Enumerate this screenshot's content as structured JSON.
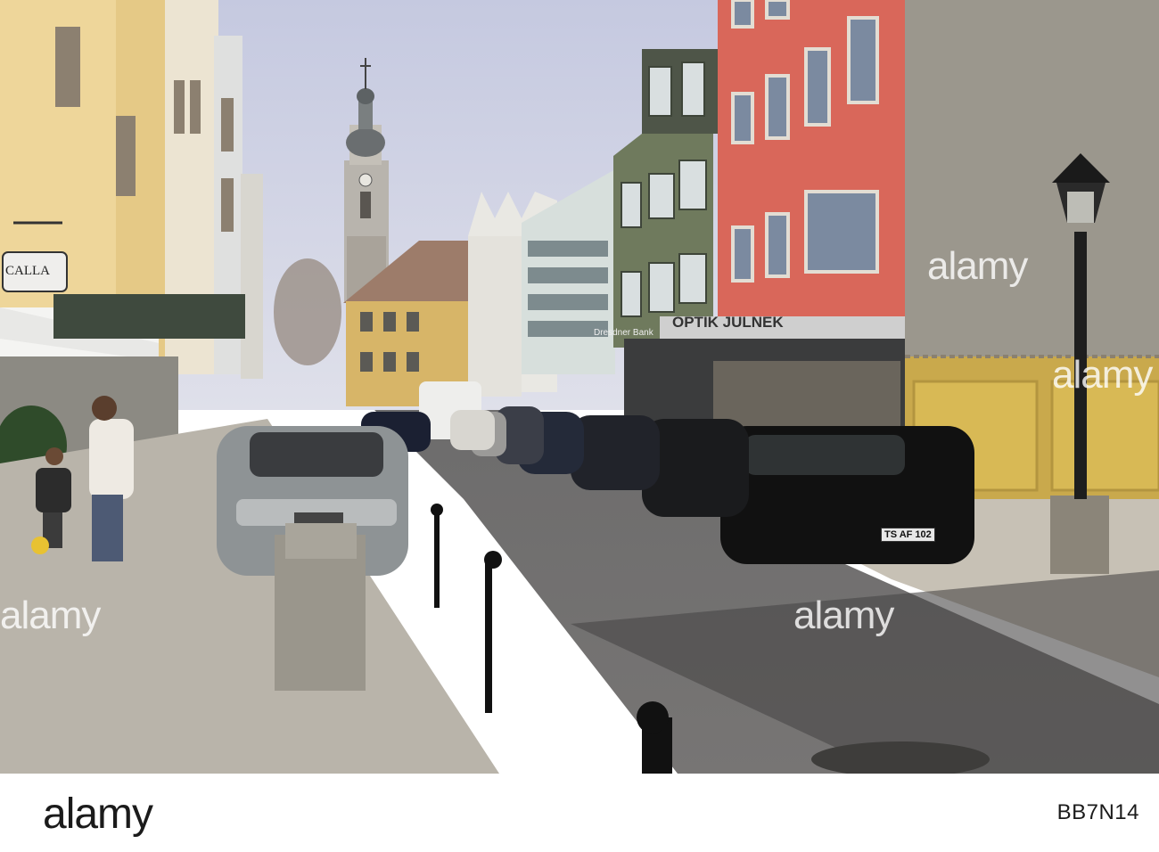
{
  "scene": {
    "shop_sign": "CALLA",
    "optik_sign": "OPTIK JULNEK",
    "bank_sign": "Dresdner Bank",
    "license_plate": "TS AF 102"
  },
  "watermarks": [
    "alamy",
    "alamy",
    "alamy",
    "alamy"
  ],
  "footer": {
    "logo": "alamy",
    "image_id": "BB7N14"
  }
}
